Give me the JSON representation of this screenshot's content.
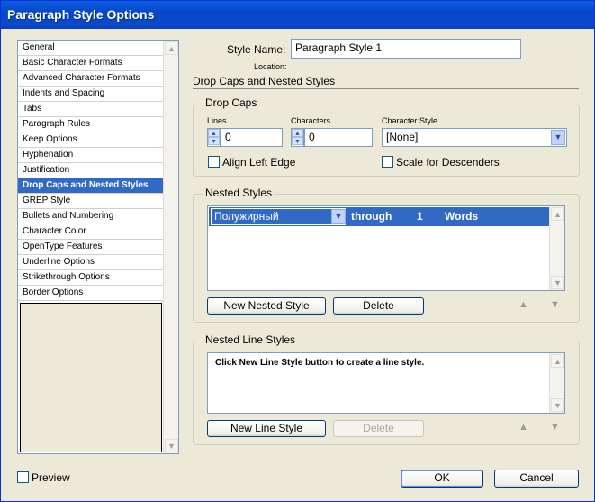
{
  "window": {
    "title": "Paragraph Style Options"
  },
  "sidebar": {
    "items": [
      {
        "label": "General"
      },
      {
        "label": "Basic Character Formats"
      },
      {
        "label": "Advanced Character Formats"
      },
      {
        "label": "Indents and Spacing"
      },
      {
        "label": "Tabs"
      },
      {
        "label": "Paragraph Rules"
      },
      {
        "label": "Keep Options"
      },
      {
        "label": "Hyphenation"
      },
      {
        "label": "Justification"
      },
      {
        "label": "Drop Caps and Nested Styles"
      },
      {
        "label": "GREP Style"
      },
      {
        "label": "Bullets and Numbering"
      },
      {
        "label": "Character Color"
      },
      {
        "label": "OpenType Features"
      },
      {
        "label": "Underline Options"
      },
      {
        "label": "Strikethrough Options"
      },
      {
        "label": "Border Options"
      }
    ],
    "selected": "Drop Caps and Nested Styles"
  },
  "header": {
    "style_name_label": "Style Name:",
    "style_name_value": "Paragraph Style 1",
    "location_label": "Location:",
    "section_title": "Drop Caps and Nested Styles"
  },
  "drop_caps": {
    "title": "Drop Caps",
    "lines_label": "Lines",
    "lines_value": "0",
    "characters_label": "Characters",
    "characters_value": "0",
    "char_style_label": "Character Style",
    "char_style_value": "[None]",
    "align_left_edge": "Align Left Edge",
    "scale_for_descenders": "Scale for Descenders"
  },
  "nested_styles": {
    "title": "Nested Styles",
    "row": {
      "style": "Полужирный",
      "mode": "through",
      "count": "1",
      "unit": "Words"
    },
    "new_button": "New Nested Style",
    "delete_button": "Delete"
  },
  "nested_line_styles": {
    "title": "Nested Line Styles",
    "message": "Click New Line Style button to create a line style.",
    "new_button": "New Line Style",
    "delete_button": "Delete"
  },
  "footer": {
    "preview_label": "Preview",
    "ok_button": "OK",
    "cancel_button": "Cancel"
  },
  "colors": {
    "selection": "#316AC5",
    "titlebar": "#0A49CC",
    "dialog_bg": "#ECE9D8"
  }
}
